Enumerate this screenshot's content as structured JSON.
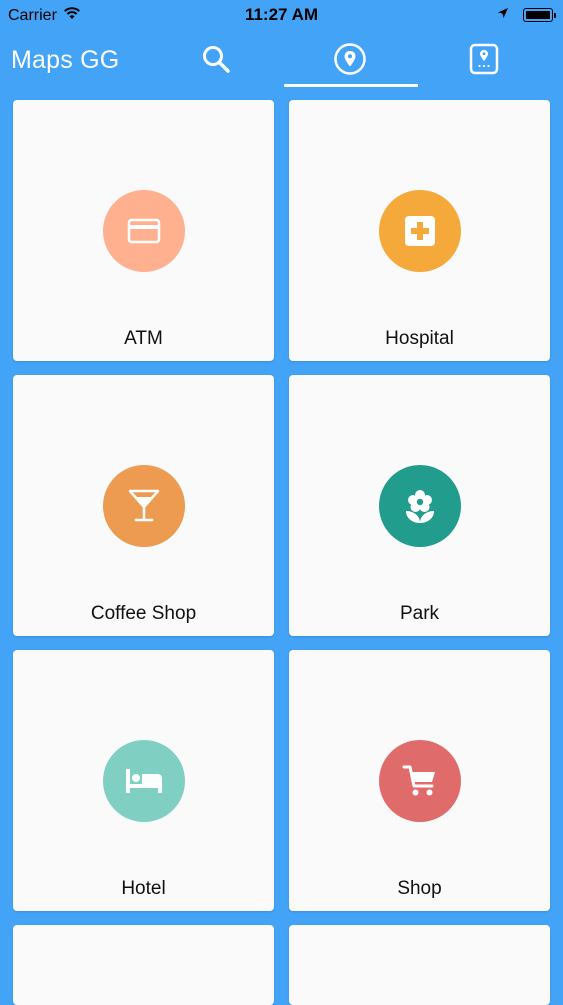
{
  "status_bar": {
    "carrier": "Carrier",
    "time": "11:27 AM"
  },
  "header": {
    "title": "Maps GG",
    "tabs": [
      {
        "icon": "search-icon"
      },
      {
        "icon": "location-pin-icon",
        "selected": true
      },
      {
        "icon": "saved-places-icon"
      }
    ]
  },
  "categories": [
    {
      "label": "ATM",
      "icon": "credit-card-icon",
      "color": "#ffb08f"
    },
    {
      "label": "Hospital",
      "icon": "medical-cross-icon",
      "color": "#f5a93a"
    },
    {
      "label": "Coffee Shop",
      "icon": "cocktail-glass-icon",
      "color": "#ec9b50"
    },
    {
      "label": "Park",
      "icon": "flower-icon",
      "color": "#229c8c"
    },
    {
      "label": "Hotel",
      "icon": "bed-icon",
      "color": "#7fcfc3"
    },
    {
      "label": "Shop",
      "icon": "shopping-cart-icon",
      "color": "#e06b6b"
    }
  ],
  "colors": {
    "background": "#42a3f7",
    "card": "#fafafa",
    "accent_white": "#ffffff"
  }
}
